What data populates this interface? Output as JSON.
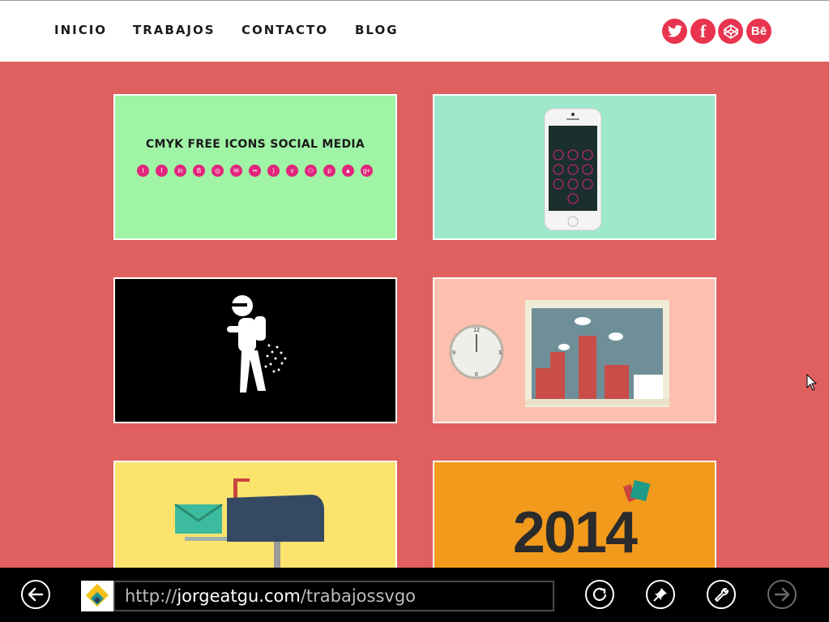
{
  "nav": {
    "items": [
      "INICIO",
      "TRABAJOS",
      "CONTACTO",
      "BLOG"
    ]
  },
  "social": [
    {
      "icon": "twitter-icon"
    },
    {
      "icon": "facebook-icon"
    },
    {
      "icon": "codepen-icon"
    },
    {
      "icon": "behance-icon",
      "label": "Bē"
    }
  ],
  "cards": {
    "cmyk": {
      "title": "CMYK FREE ICONS SOCIAL MEDIA"
    },
    "year": {
      "text": "2014"
    }
  },
  "browser": {
    "url_prefix": "http://",
    "url_host": "jorgeatgu.com",
    "url_path": "/trabajossvgo"
  },
  "colors": {
    "background": "#e05f5f",
    "social": "#e8344f",
    "cmyk_icon": "#e0257b",
    "card_green": "#a0f4a6",
    "card_mint": "#9ee9cc",
    "card_peach": "#fdbfae",
    "card_yellow": "#fce36c",
    "card_orange": "#f29a1b"
  }
}
